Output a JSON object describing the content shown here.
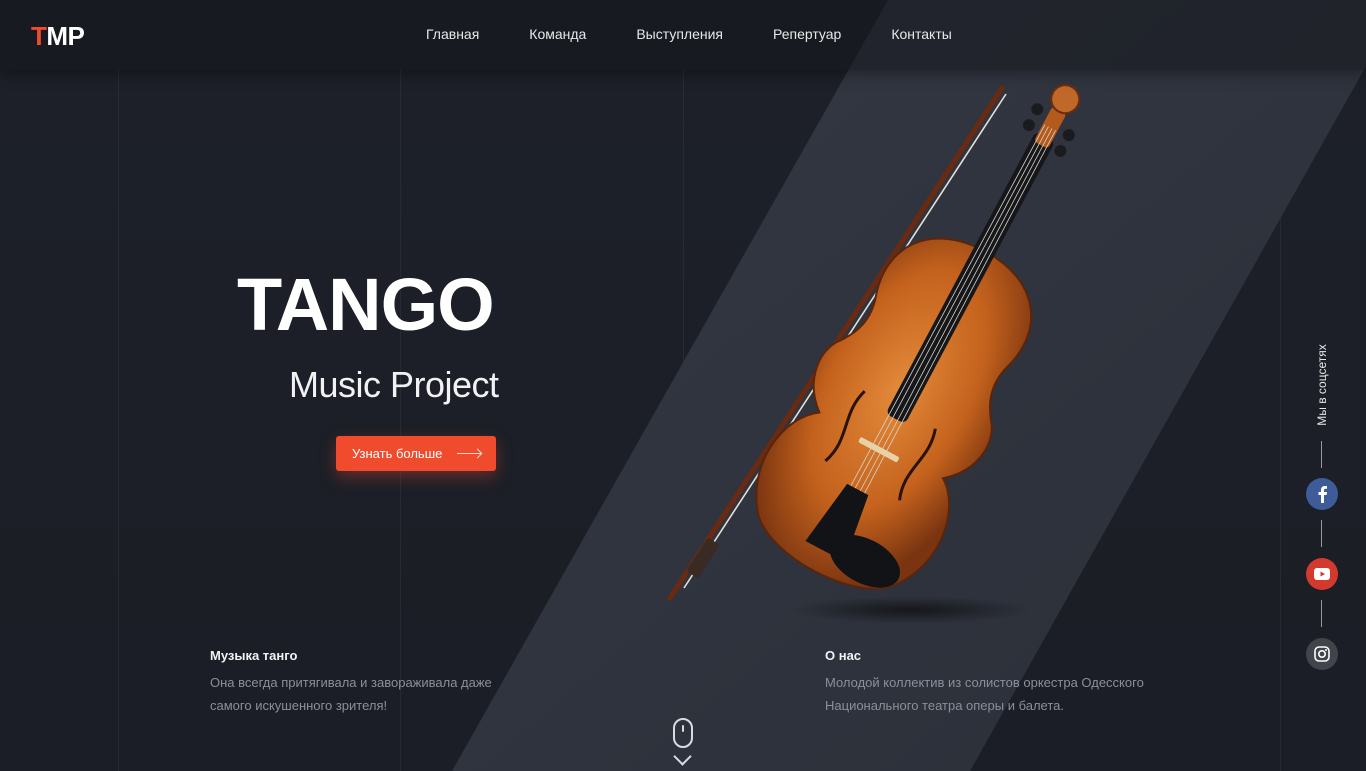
{
  "brand": {
    "logo_first": "T",
    "logo_rest": "MP"
  },
  "nav": {
    "items": [
      "Главная",
      "Команда",
      "Выступления",
      "Репертуар",
      "Контакты"
    ]
  },
  "hero": {
    "title": "TANGO",
    "subtitle": "Music Project",
    "cta_label": "Узнать больше"
  },
  "info_left": {
    "heading": "Музыка танго",
    "text": "Она всегда притягивала и завораживала даже самого искушенного зрителя!"
  },
  "info_right": {
    "heading": "О нас",
    "text": "Молодой коллектив из солистов оркестра Одесского Национального театра оперы и балета."
  },
  "social": {
    "label": "Мы в соцсетях",
    "links": [
      "facebook-icon",
      "youtube-icon",
      "instagram-icon"
    ]
  },
  "colors": {
    "accent": "#f04b2d",
    "background": "#1c1f27",
    "diagonal_panel": "#2e323c",
    "facebook": "#3d5c99",
    "youtube": "#d23a2e",
    "instagram": "#41444b"
  }
}
